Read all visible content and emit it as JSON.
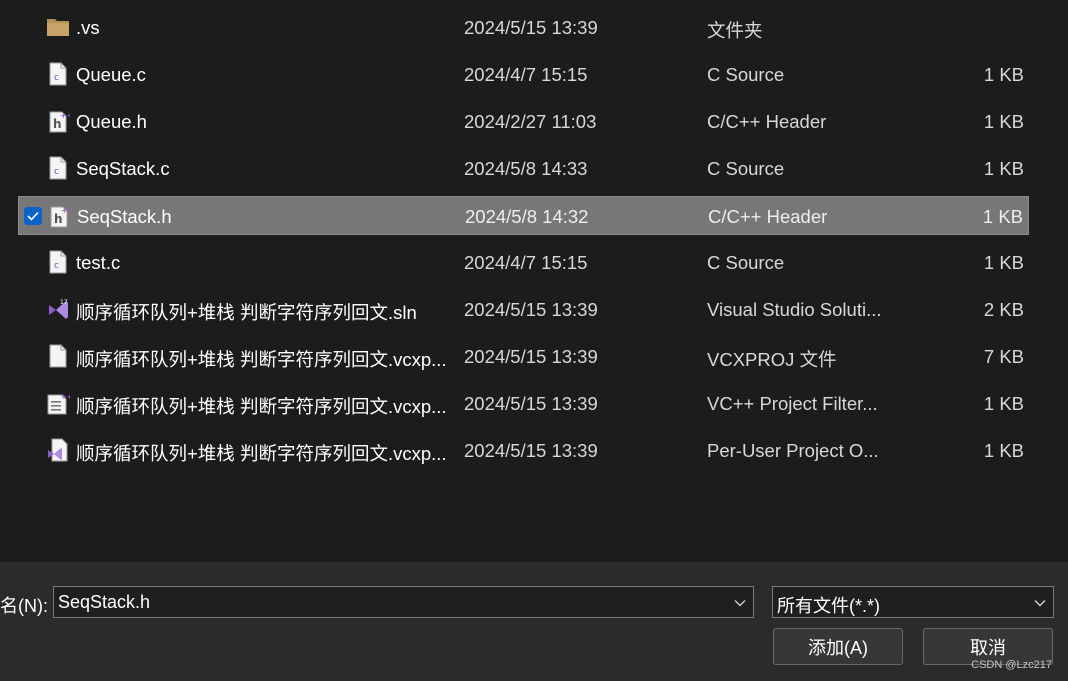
{
  "files": [
    {
      "name": ".vs",
      "date": "2024/5/15 13:39",
      "type": "文件夹",
      "size": "",
      "icon": "folder-icon"
    },
    {
      "name": "Queue.c",
      "date": "2024/4/7 15:15",
      "type": "C Source",
      "size": "1 KB",
      "icon": "c-source-file-icon"
    },
    {
      "name": "Queue.h",
      "date": "2024/2/27 11:03",
      "type": "C/C++ Header",
      "size": "1 KB",
      "icon": "header-file-icon"
    },
    {
      "name": "SeqStack.c",
      "date": "2024/5/8 14:33",
      "type": "C Source",
      "size": "1 KB",
      "icon": "c-source-file-icon"
    },
    {
      "name": "SeqStack.h",
      "date": "2024/5/8 14:32",
      "type": "C/C++ Header",
      "size": "1 KB",
      "icon": "header-file-icon",
      "selected": true
    },
    {
      "name": "test.c",
      "date": "2024/4/7 15:15",
      "type": "C Source",
      "size": "1 KB",
      "icon": "c-source-file-icon"
    },
    {
      "name": "顺序循环队列+堆栈 判断字符序列回文.sln",
      "date": "2024/5/15 13:39",
      "type": "Visual Studio Soluti...",
      "size": "2 KB",
      "icon": "vs-solution-icon"
    },
    {
      "name": "顺序循环队列+堆栈 判断字符序列回文.vcxp...",
      "date": "2024/5/15 13:39",
      "type": "VCXPROJ 文件",
      "size": "7 KB",
      "icon": "blank-file-icon"
    },
    {
      "name": "顺序循环队列+堆栈 判断字符序列回文.vcxp...",
      "date": "2024/5/15 13:39",
      "type": "VC++ Project Filter...",
      "size": "1 KB",
      "icon": "project-filter-file-icon"
    },
    {
      "name": "顺序循环队列+堆栈 判断字符序列回文.vcxp...",
      "date": "2024/5/15 13:39",
      "type": "Per-User Project O...",
      "size": "1 KB",
      "icon": "vs-user-file-icon"
    }
  ],
  "footer": {
    "filename_label": "名(N):",
    "filename_value": "SeqStack.h",
    "filter_value": "所有文件(*.*)",
    "add_button": "添加(A)",
    "cancel_button": "取消"
  },
  "watermark": "CSDN @Lzc217",
  "colors": {
    "background": "#1c1c1c",
    "selected_row": "#777777",
    "checkbox": "#0a64c8",
    "footer": "#2b2b2b",
    "vs_purple": "#8a5cc9"
  }
}
